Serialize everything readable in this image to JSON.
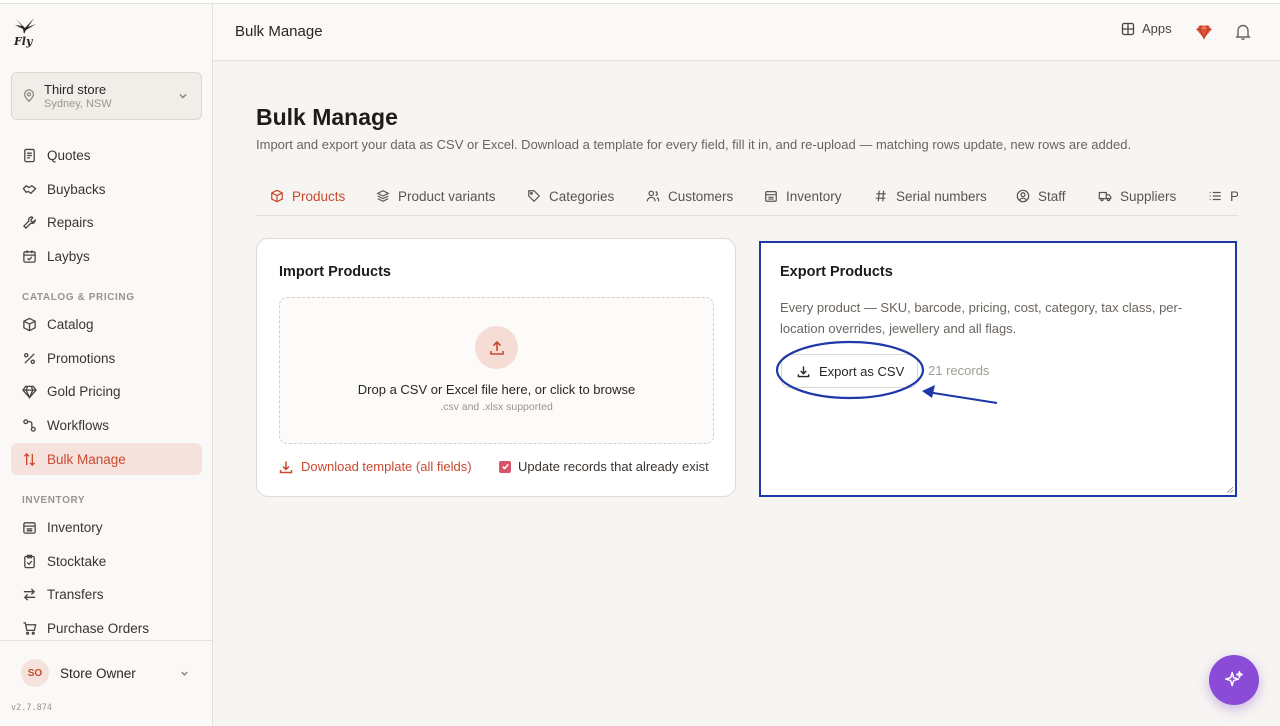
{
  "app": {
    "logo_text": "Fly",
    "version": "v2.7.874"
  },
  "store": {
    "name": "Third store",
    "location": "Sydney, NSW"
  },
  "sidebar": {
    "items": [
      {
        "label": "Quotes",
        "icon": "document-icon"
      },
      {
        "label": "Buybacks",
        "icon": "handshake-icon"
      },
      {
        "label": "Repairs",
        "icon": "wrench-icon"
      },
      {
        "label": "Laybys",
        "icon": "calendar-icon"
      }
    ],
    "sections": [
      {
        "label": "CATALOG & PRICING",
        "items": [
          {
            "label": "Catalog",
            "icon": "box-icon"
          },
          {
            "label": "Promotions",
            "icon": "percent-icon"
          },
          {
            "label": "Gold Pricing",
            "icon": "diamond-icon"
          },
          {
            "label": "Workflows",
            "icon": "workflow-icon"
          },
          {
            "label": "Bulk Manage",
            "icon": "sort-arrows-icon",
            "active": true
          }
        ]
      },
      {
        "label": "INVENTORY",
        "items": [
          {
            "label": "Inventory",
            "icon": "inventory-icon"
          },
          {
            "label": "Stocktake",
            "icon": "clipboard-icon"
          },
          {
            "label": "Transfers",
            "icon": "transfer-icon"
          },
          {
            "label": "Purchase Orders",
            "icon": "cart-icon"
          }
        ]
      }
    ]
  },
  "user": {
    "initials": "SO",
    "name": "Store Owner"
  },
  "header": {
    "title": "Bulk Manage",
    "apps_label": "Apps"
  },
  "main": {
    "title": "Bulk Manage",
    "description": "Import and export your data as CSV or Excel. Download a template for every field, fill it in, and re-upload — matching rows update, new rows are added.",
    "tabs": [
      {
        "label": "Products",
        "active": true
      },
      {
        "label": "Product variants"
      },
      {
        "label": "Categories"
      },
      {
        "label": "Customers"
      },
      {
        "label": "Inventory"
      },
      {
        "label": "Serial numbers"
      },
      {
        "label": "Staff"
      },
      {
        "label": "Suppliers"
      },
      {
        "label": "P"
      }
    ],
    "import": {
      "title": "Import Products",
      "drop_text": "Drop a CSV or Excel file here, or click to browse",
      "drop_sub": ".csv and .xlsx supported",
      "template_label": "Download template (all fields)",
      "update_label": "Update records that already exist",
      "update_checked": true
    },
    "export": {
      "title": "Export Products",
      "description": "Every product — SKU, barcode, pricing, cost, category, tax class, per-location overrides, jewellery and all flags.",
      "button_label": "Export as CSV",
      "records": "21 records"
    }
  },
  "colors": {
    "accent": "#c9492e",
    "annotation": "#1f38a8",
    "fab": "#8a4bd6"
  }
}
